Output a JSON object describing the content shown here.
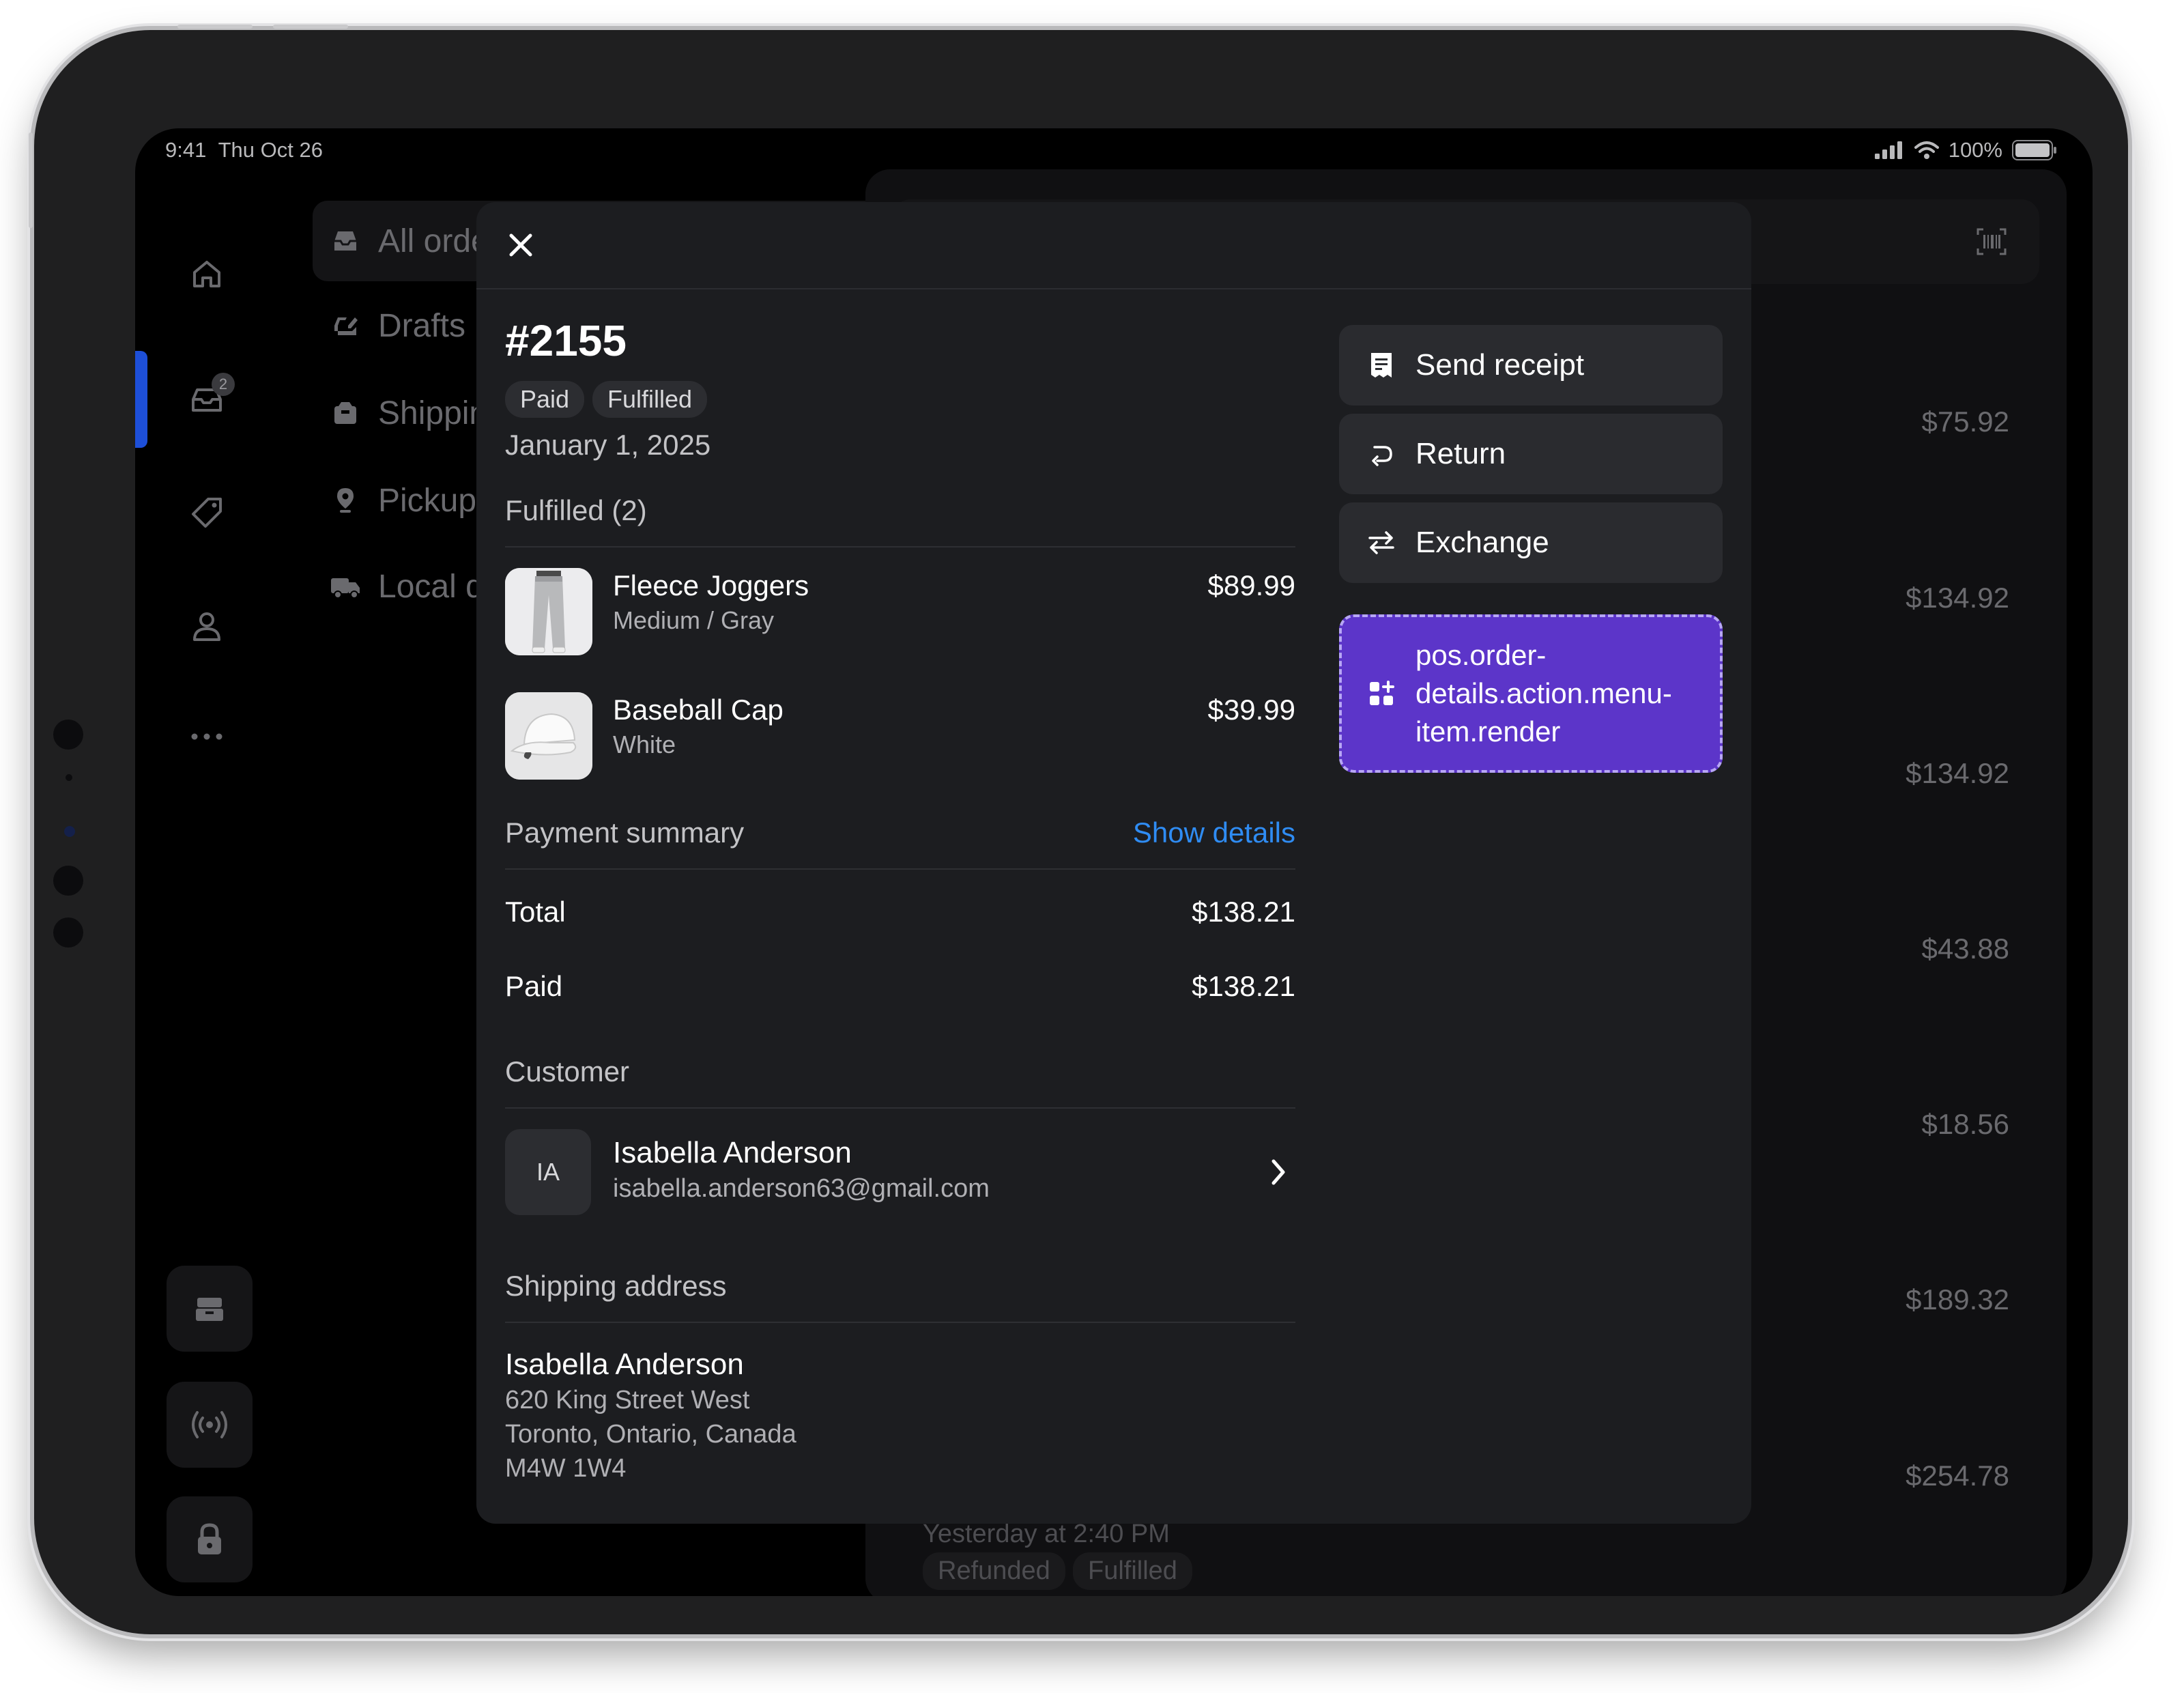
{
  "status": {
    "time": "9:41",
    "date": "Thu Oct 26",
    "battery": "100%"
  },
  "rail": {
    "orders_badge": "2"
  },
  "list": {
    "items": [
      {
        "label": "All orders",
        "icon": "inbox-icon"
      },
      {
        "label": "Drafts",
        "icon": "draft-icon"
      },
      {
        "label": "Shipping",
        "icon": "package-icon"
      },
      {
        "label": "Pickup",
        "icon": "location-pin-icon"
      },
      {
        "label": "Local de",
        "icon": "truck-icon"
      }
    ]
  },
  "background": {
    "prices": [
      "$75.92",
      "$134.92",
      "$134.92",
      "$43.88",
      "$18.56",
      "$189.32",
      "$254.78"
    ],
    "last_time": "Yesterday at 2:40 PM",
    "last_badges": [
      "Refunded",
      "Fulfilled"
    ]
  },
  "order": {
    "number": "#2155",
    "badges": [
      "Paid",
      "Fulfilled"
    ],
    "date": "January 1, 2025",
    "fulfilled_header": "Fulfilled (2)",
    "items": [
      {
        "name": "Fleece Joggers",
        "variant": "Medium / Gray",
        "price": "$89.99"
      },
      {
        "name": "Baseball Cap",
        "variant": "White",
        "price": "$39.99"
      }
    ],
    "payment": {
      "title": "Payment summary",
      "show_details": "Show details",
      "total_label": "Total",
      "total_value": "$138.21",
      "paid_label": "Paid",
      "paid_value": "$138.21"
    },
    "customer": {
      "title": "Customer",
      "initials": "IA",
      "name": "Isabella Anderson",
      "email": "isabella.anderson63@gmail.com"
    },
    "shipping": {
      "title": "Shipping address",
      "name": "Isabella Anderson",
      "line1": "620 King Street West",
      "line2": "Toronto, Ontario, Canada",
      "line3": "M4W 1W4"
    }
  },
  "actions": {
    "send_receipt": "Send receipt",
    "return": "Return",
    "exchange": "Exchange",
    "extension": "pos.order-details.action.menu-item.render"
  },
  "colors": {
    "accent_link": "#2f8cf3",
    "extension_bg": "#5c35c9",
    "rail_indicator": "#1d4fd8"
  }
}
